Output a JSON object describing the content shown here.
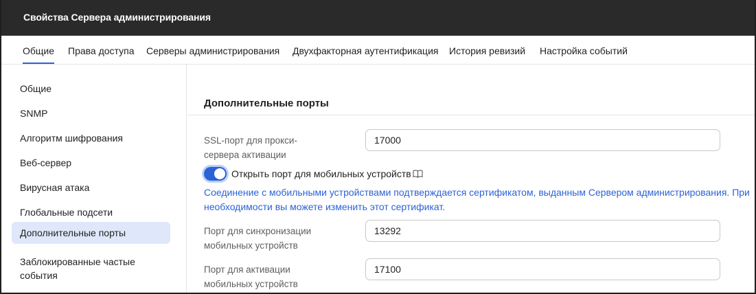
{
  "window": {
    "title": "Свойства Сервера администрирования"
  },
  "tabs": [
    {
      "label": "Общие"
    },
    {
      "label": "Права доступа"
    },
    {
      "label": "Серверы администрирования"
    },
    {
      "label": "Двухфакторная аутентификация"
    },
    {
      "label": "История ревизий"
    },
    {
      "label": "Настройка событий"
    }
  ],
  "active_tab": "Общие",
  "sidebar": {
    "items": [
      {
        "label": "Общие"
      },
      {
        "label": "SNMP"
      },
      {
        "label": "Алгоритм шифрования"
      },
      {
        "label": "Веб-сервер"
      },
      {
        "label": "Вирусная атака"
      },
      {
        "label": "Глобальные подсети"
      },
      {
        "label": "Дополнительные порты"
      },
      {
        "label": "Заблокированные частые события"
      }
    ],
    "active_item": "Дополнительные порты"
  },
  "main": {
    "section_title": "Дополнительные порты",
    "ssl_proxy_port": {
      "label": "SSL-порт для прокси-сервера активации",
      "value": "17000"
    },
    "mobile_port_toggle": {
      "label": "Открыть порт для мобильных устройств",
      "enabled": true,
      "icon": "book-icon"
    },
    "info_text": "Соединение с мобильными устройствами подтверждается сертификатом, выданным Сервером администрирования. При необходимости вы можете изменить этот сертификат.",
    "mobile_sync_port": {
      "label": "Порт для синхронизации мобильных устройств",
      "value": "13292"
    },
    "mobile_activation_port": {
      "label": "Порт для активации мобильных устройств",
      "value": "17100"
    }
  },
  "colors": {
    "accent": "#2b62d6",
    "titlebar": "#2a2a2a",
    "active_item_bg": "#dfe8fa"
  }
}
